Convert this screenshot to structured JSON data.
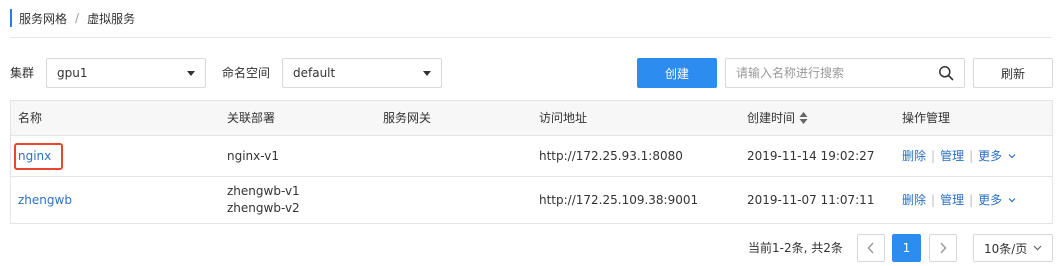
{
  "breadcrumb": {
    "parent": "服务网格",
    "separator": "/",
    "current": "虚拟服务"
  },
  "filters": {
    "cluster_label": "集群",
    "cluster_value": "gpu1",
    "namespace_label": "命名空间",
    "namespace_value": "default"
  },
  "toolbar": {
    "create_label": "创建",
    "search_placeholder": "请输入名称进行搜索",
    "refresh_label": "刷新"
  },
  "table": {
    "headers": [
      "名称",
      "关联部署",
      "服务网关",
      "访问地址",
      "创建时间",
      "操作管理"
    ],
    "rows": [
      {
        "name": "nginx",
        "deployments": [
          "nginx-v1"
        ],
        "gateway": "",
        "address": "http://172.25.93.1:8080",
        "created": "2019-11-14 19:02:27"
      },
      {
        "name": "zhengwb",
        "deployments": [
          "zhengwb-v1",
          "zhengwb-v2"
        ],
        "gateway": "",
        "address": "http://172.25.109.38:9001",
        "created": "2019-11-07 11:07:11"
      }
    ],
    "ops": {
      "delete": "删除",
      "manage": "管理",
      "more": "更多",
      "divider": "|"
    }
  },
  "pagination": {
    "summary": "当前1-2条, 共2条",
    "current_page": "1",
    "page_size": "10条/页"
  },
  "colors": {
    "primary": "#2d8cf0",
    "link": "#2d6fc4",
    "highlight": "#e8462e",
    "accent_bar": "#2d7be5"
  },
  "icons": {
    "search": "search-icon",
    "sort": "sort-icon",
    "caret": "caret-down-icon",
    "prev": "chevron-left-icon",
    "next": "chevron-right-icon"
  }
}
